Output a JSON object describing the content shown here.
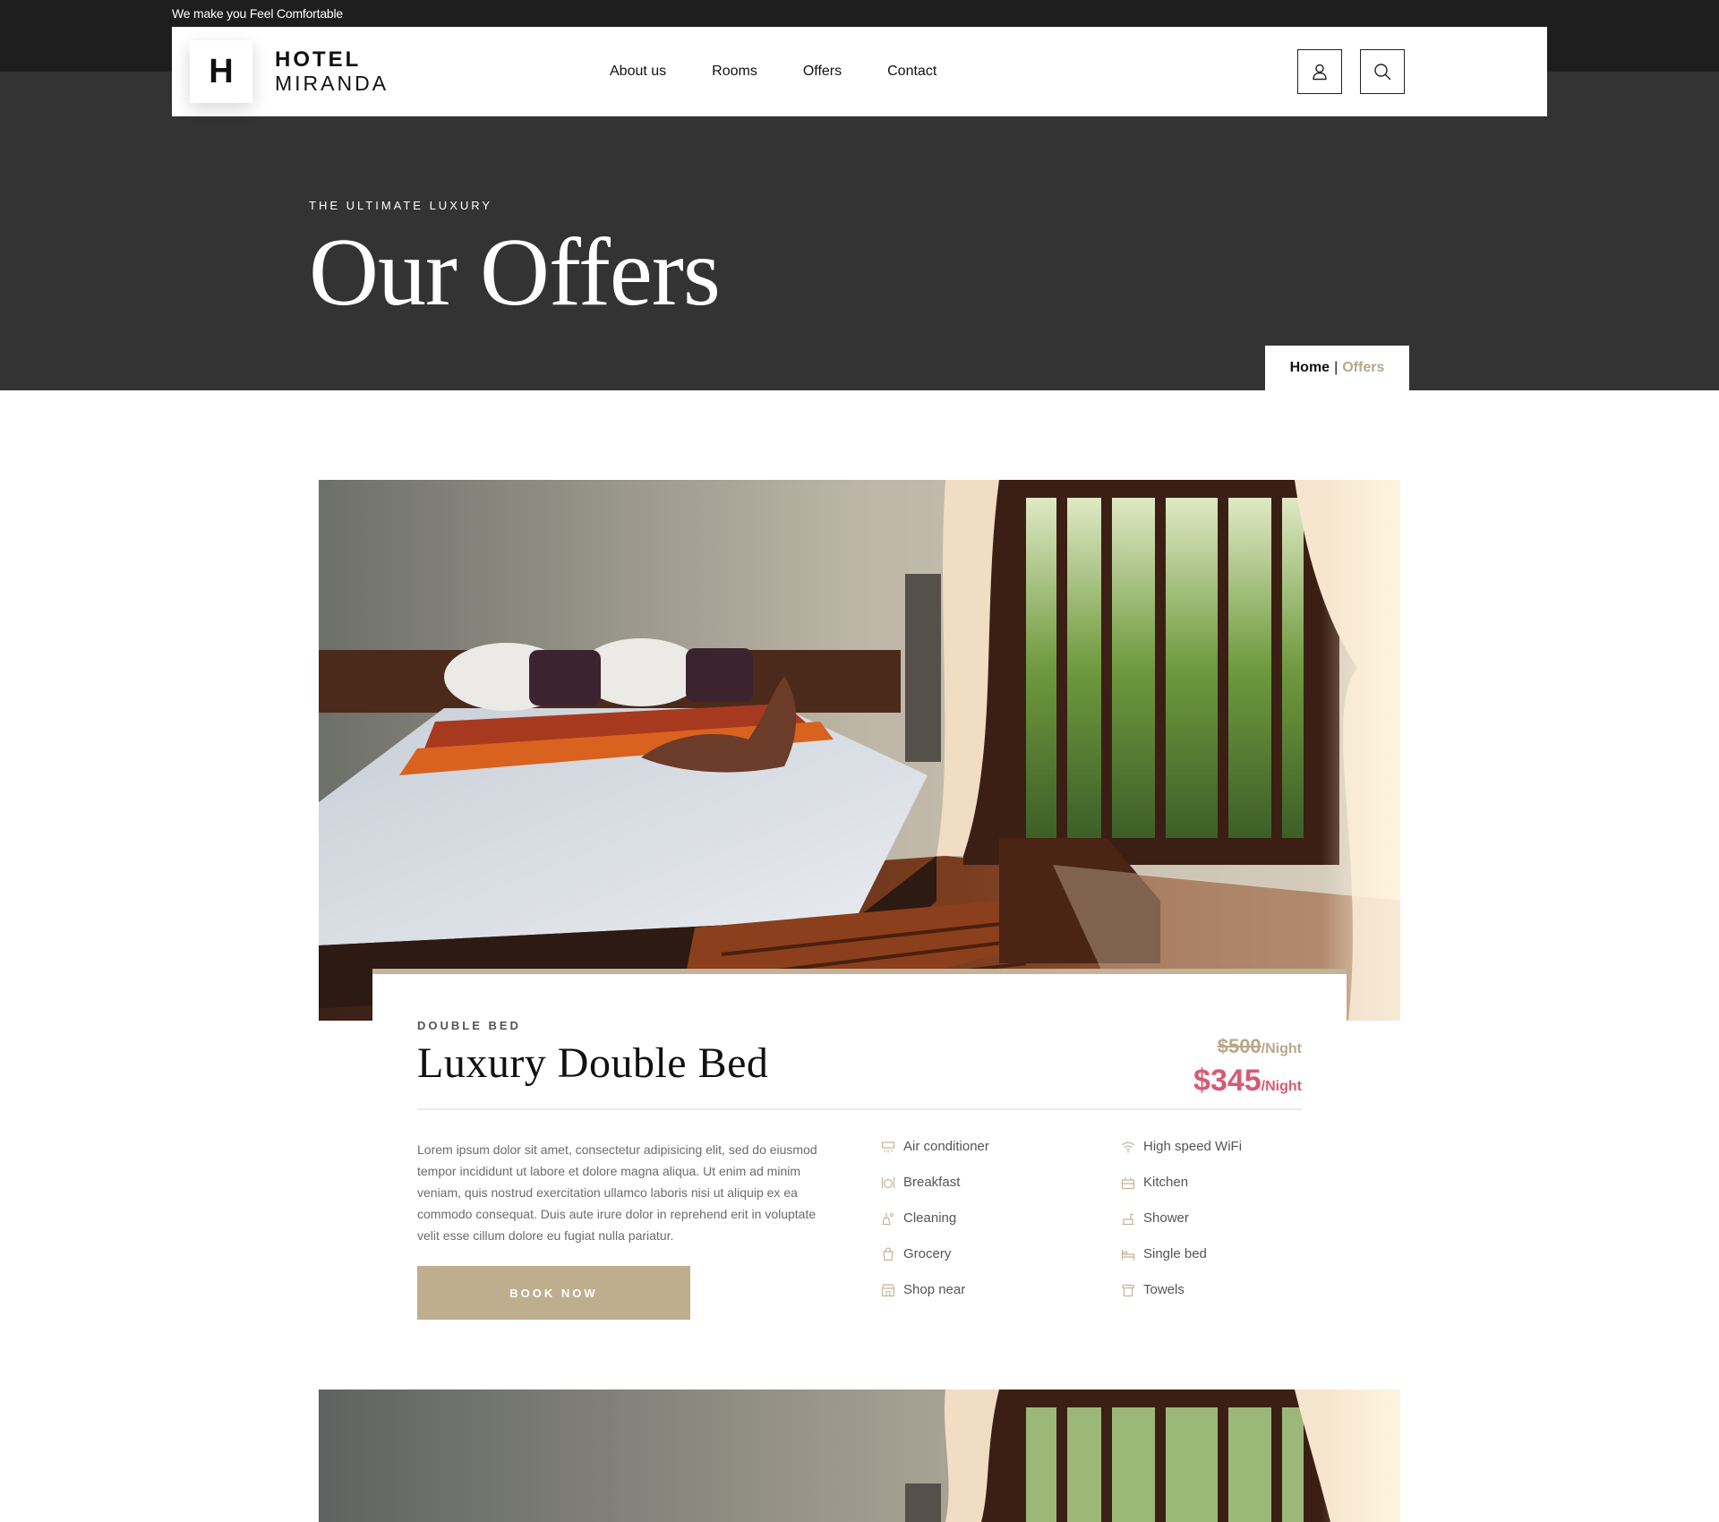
{
  "topbar": {
    "tagline": "We make you Feel Comfortable"
  },
  "header": {
    "logo_letter": "H",
    "logo_line1": "HOTEL",
    "logo_line2": "MIRANDA",
    "nav": [
      "About us",
      "Rooms",
      "Offers",
      "Contact"
    ],
    "icons": [
      "user-icon",
      "search-icon"
    ]
  },
  "hero": {
    "kicker": "THE ULTIMATE LUXURY",
    "title": "Our Offers",
    "breadcrumb": {
      "home": "Home",
      "separator": "|",
      "current": "Offers"
    }
  },
  "offer": {
    "kicker": "DOUBLE BED",
    "title": "Luxury Double Bed",
    "old_price": "$500",
    "old_price_unit": "/Night",
    "new_price": "$345",
    "new_price_unit": "/Night",
    "description": "Lorem ipsum dolor sit amet, consectetur adipisicing elit, sed do eiusmod tempor incididunt ut labore et dolore magna aliqua. Ut enim ad minim veniam, quis nostrud exercitation ullamco laboris nisi ut aliquip ex ea commodo consequat. Duis aute irure dolor in reprehend erit in voluptate velit esse cillum dolore eu fugiat nulla pariatur.",
    "book_label": "BOOK NOW",
    "amenities_col1": [
      {
        "label": "Air conditioner",
        "icon": "air-conditioner-icon"
      },
      {
        "label": "Breakfast",
        "icon": "breakfast-icon"
      },
      {
        "label": "Cleaning",
        "icon": "cleaning-icon"
      },
      {
        "label": "Grocery",
        "icon": "grocery-icon"
      },
      {
        "label": "Shop near",
        "icon": "shop-icon"
      }
    ],
    "amenities_col2": [
      {
        "label": "High speed WiFi",
        "icon": "wifi-icon"
      },
      {
        "label": "Kitchen",
        "icon": "kitchen-icon"
      },
      {
        "label": "Shower",
        "icon": "shower-icon"
      },
      {
        "label": "Single bed",
        "icon": "bed-icon"
      },
      {
        "label": "Towels",
        "icon": "towel-icon"
      }
    ]
  },
  "colors": {
    "dark_top": "#1e1e1e",
    "hero_bg": "#333333",
    "accent_gold": "#bfae8e",
    "price_pink": "#d75a74"
  }
}
